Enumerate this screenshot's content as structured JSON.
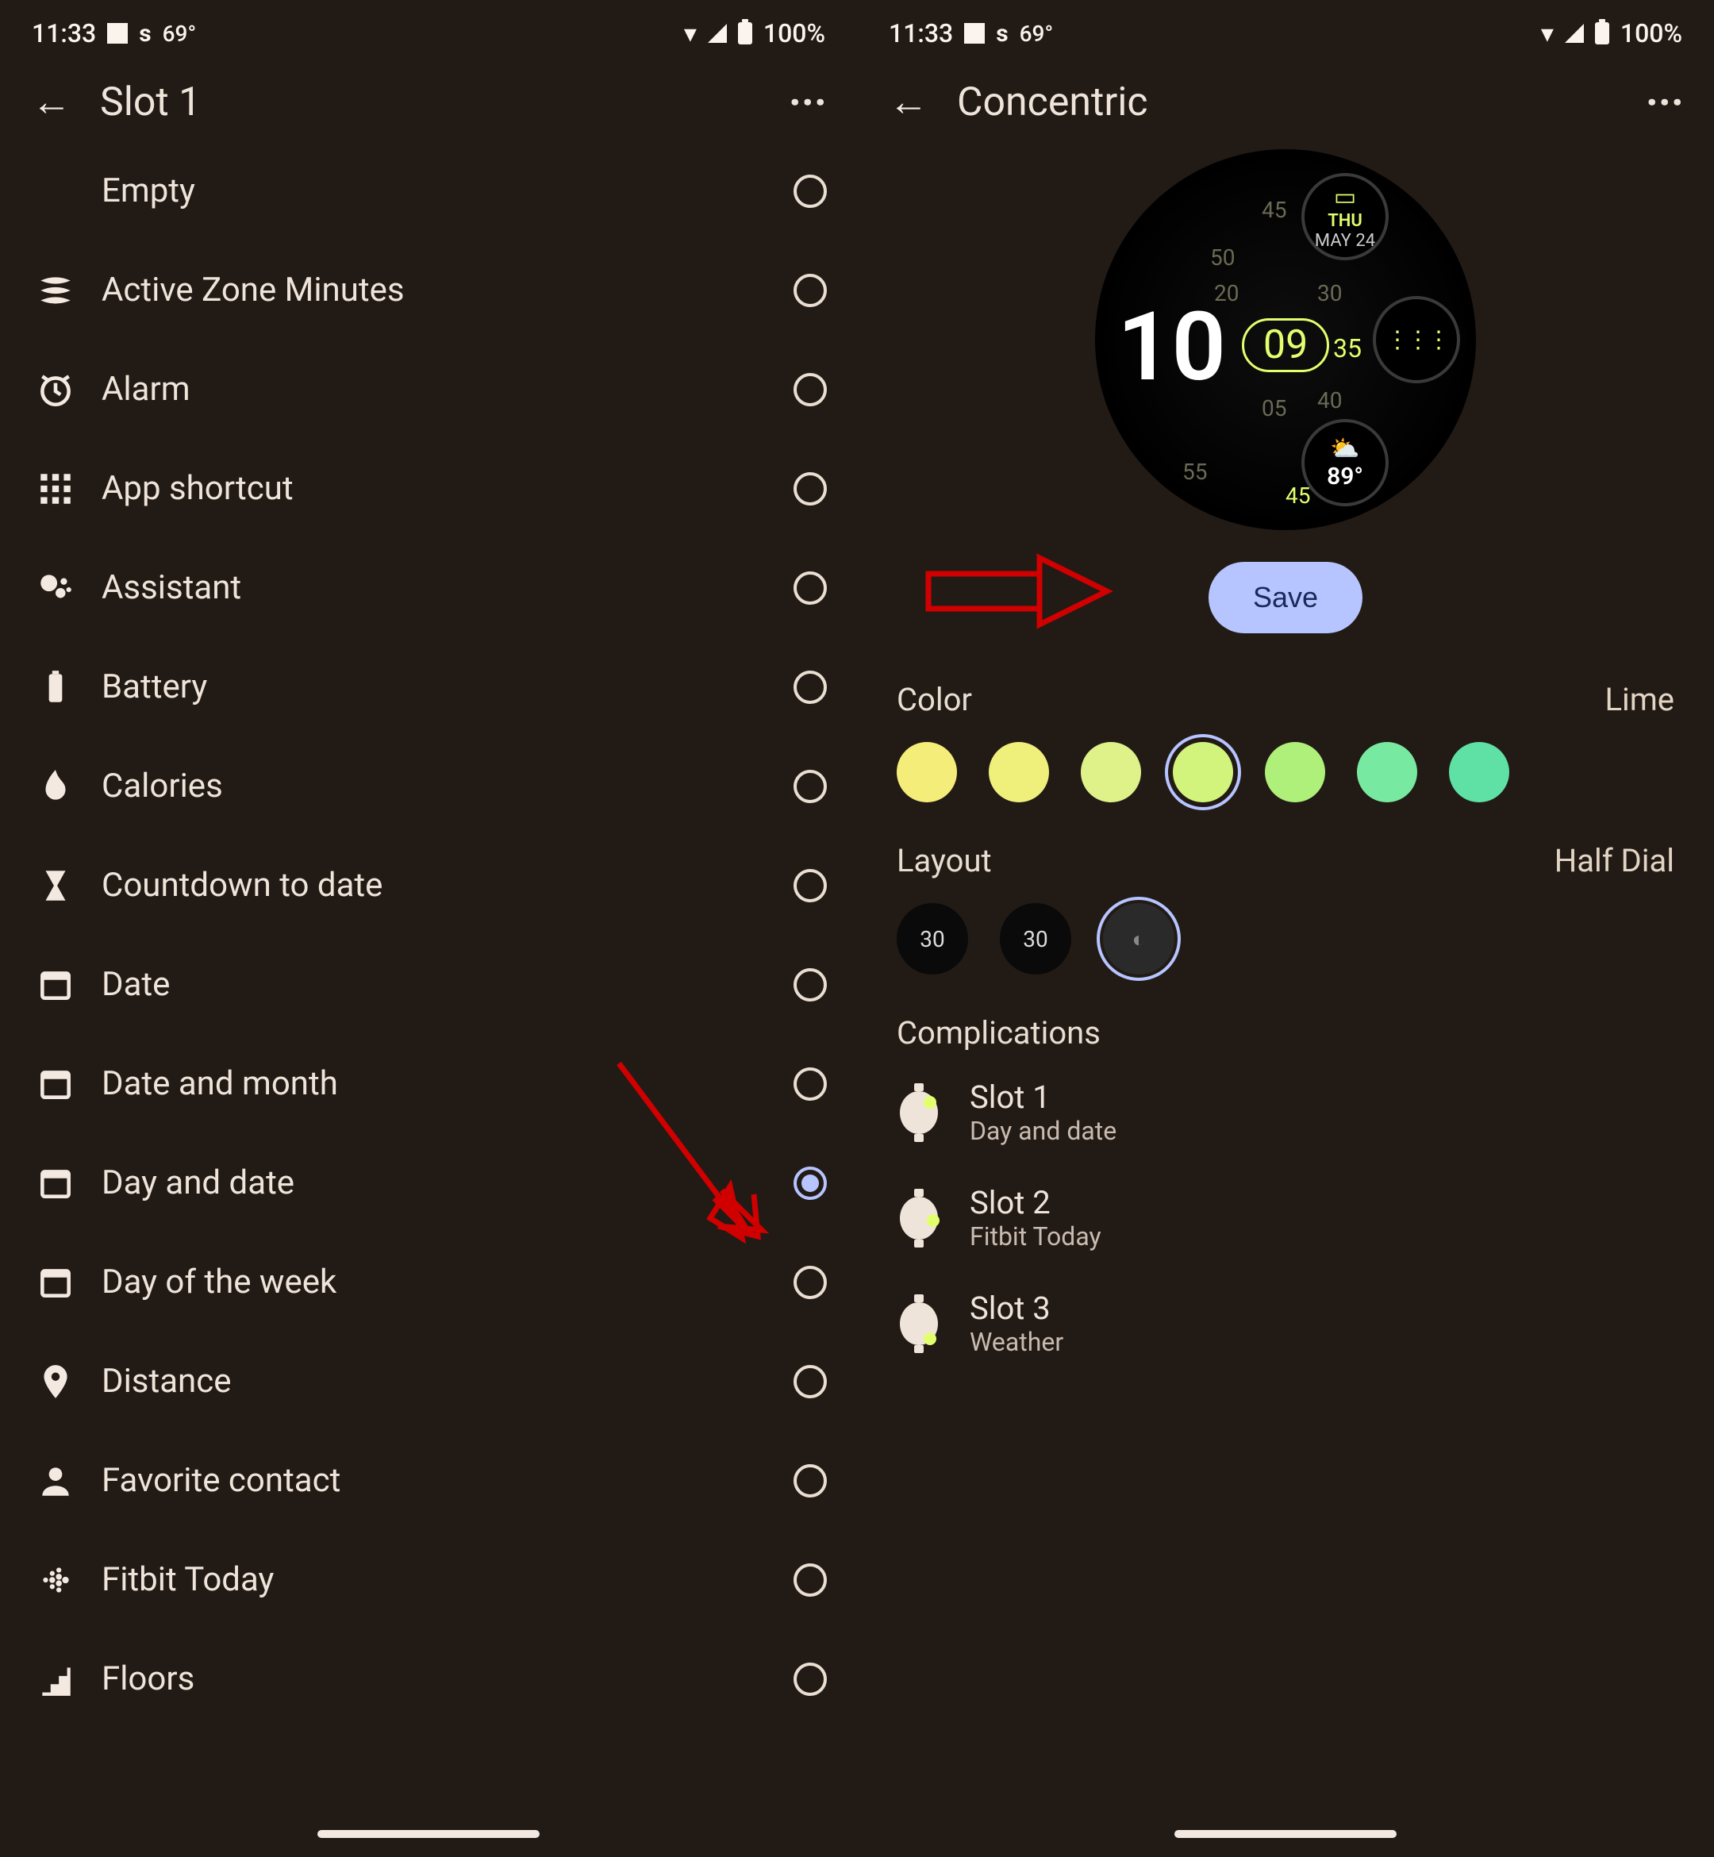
{
  "status": {
    "time": "11:33",
    "s_indicator": "s",
    "temperature": "69°",
    "battery_pct": "100%"
  },
  "left": {
    "title": "Slot 1",
    "options": [
      {
        "icon": "empty-icon",
        "label": "Empty",
        "selected": false
      },
      {
        "icon": "azm-icon",
        "label": "Active Zone Minutes",
        "selected": false
      },
      {
        "icon": "alarm-icon",
        "label": "Alarm",
        "selected": false
      },
      {
        "icon": "apps-icon",
        "label": "App shortcut",
        "selected": false
      },
      {
        "icon": "assistant-icon",
        "label": "Assistant",
        "selected": false
      },
      {
        "icon": "battery-icon",
        "label": "Battery",
        "selected": false
      },
      {
        "icon": "calories-icon",
        "label": "Calories",
        "selected": false
      },
      {
        "icon": "countdown-icon",
        "label": "Countdown to date",
        "selected": false
      },
      {
        "icon": "date-icon",
        "label": "Date",
        "selected": false
      },
      {
        "icon": "date-month-icon",
        "label": "Date and month",
        "selected": false
      },
      {
        "icon": "day-date-icon",
        "label": "Day and date",
        "selected": true
      },
      {
        "icon": "day-week-icon",
        "label": "Day of the week",
        "selected": false
      },
      {
        "icon": "distance-icon",
        "label": "Distance",
        "selected": false
      },
      {
        "icon": "contact-icon",
        "label": "Favorite contact",
        "selected": false
      },
      {
        "icon": "fitbit-icon",
        "label": "Fitbit Today",
        "selected": false
      },
      {
        "icon": "floors-icon",
        "label": "Floors",
        "selected": false
      }
    ]
  },
  "right": {
    "title": "Concentric",
    "save_label": "Save",
    "preview": {
      "hour": "10",
      "minute": "09",
      "sec_highlight": "35",
      "ticks": [
        "45",
        "50",
        "55",
        "05",
        "20",
        "30",
        "40",
        "45"
      ],
      "comp_top": {
        "icon": "calendar",
        "line1": "THU",
        "line2": "MAY 24"
      },
      "comp_mid": {
        "icon": "fitbit"
      },
      "comp_bot": {
        "icon": "weather",
        "value": "89°"
      }
    },
    "color": {
      "label": "Color",
      "value": "Lime",
      "swatches": [
        "#f4ed7a",
        "#eff07b",
        "#dff28a",
        "#d2f47c",
        "#aef07a",
        "#78e9a1",
        "#5fe0a5"
      ],
      "selected_index": 3
    },
    "layout": {
      "label": "Layout",
      "value": "Half Dial",
      "options": [
        "30",
        "30",
        "dots"
      ],
      "selected_index": 2
    },
    "complications": {
      "label": "Complications",
      "slots": [
        {
          "title": "Slot 1",
          "subtitle": "Day and date",
          "dot": "top-right"
        },
        {
          "title": "Slot 2",
          "subtitle": "Fitbit Today",
          "dot": "right"
        },
        {
          "title": "Slot 3",
          "subtitle": "Weather",
          "dot": "bottom-right"
        }
      ]
    }
  }
}
